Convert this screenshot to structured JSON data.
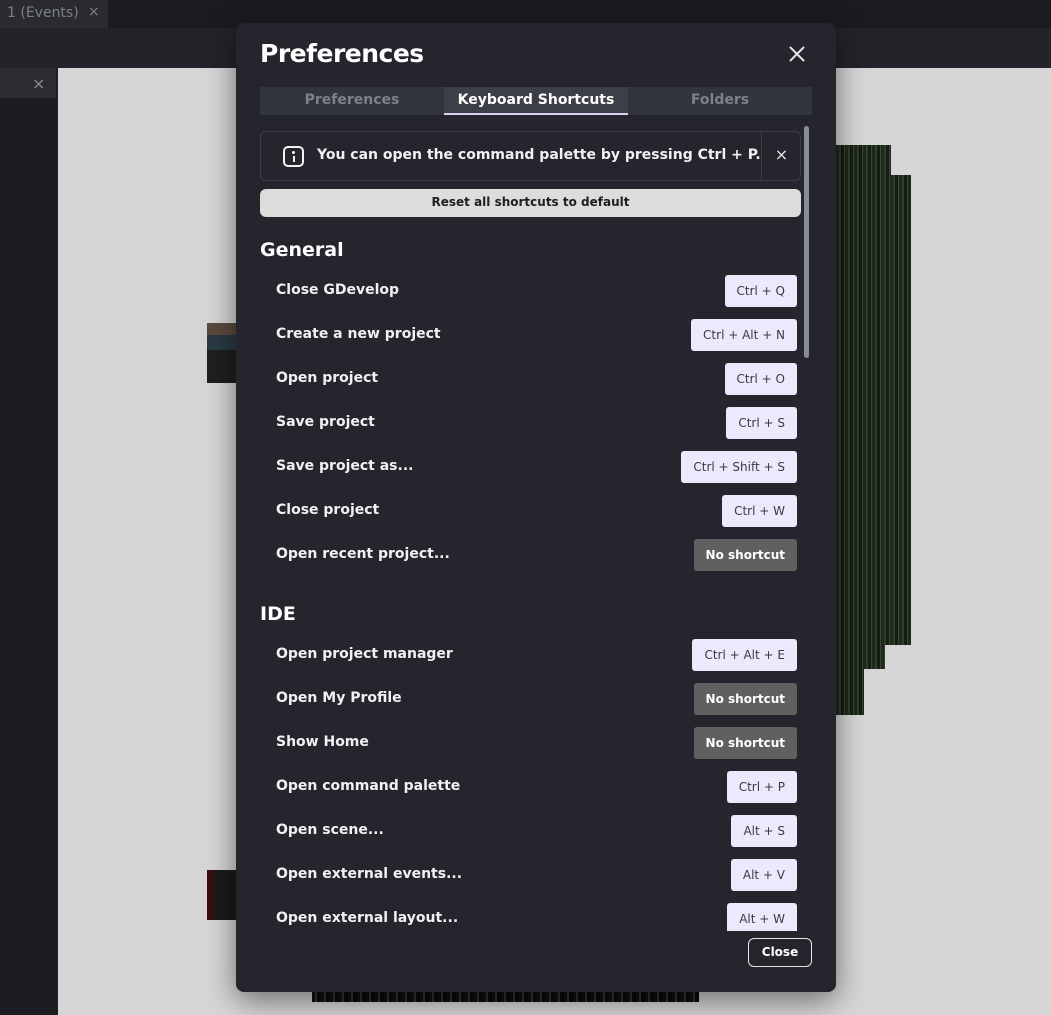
{
  "background": {
    "tab_label": "1 (Events)",
    "tab_close": "×",
    "panel_close": "×"
  },
  "dialog": {
    "title": "Preferences",
    "close_icon": "close-icon",
    "tabs": [
      {
        "label": "Preferences",
        "active": false
      },
      {
        "label": "Keyboard Shortcuts",
        "active": true
      },
      {
        "label": "Folders",
        "active": false
      }
    ],
    "info_banner": {
      "icon": "info-icon",
      "text": "You can open the command palette by pressing Ctrl + P.",
      "close": "×"
    },
    "reset_button": "Reset all shortcuts to default",
    "sections": [
      {
        "title": "General",
        "items": [
          {
            "label": "Close GDevelop",
            "shortcut": "Ctrl + Q"
          },
          {
            "label": "Create a new project",
            "shortcut": "Ctrl + Alt + N"
          },
          {
            "label": "Open project",
            "shortcut": "Ctrl + O"
          },
          {
            "label": "Save project",
            "shortcut": "Ctrl + S"
          },
          {
            "label": "Save project as...",
            "shortcut": "Ctrl + Shift + S"
          },
          {
            "label": "Close project",
            "shortcut": "Ctrl + W"
          },
          {
            "label": "Open recent project...",
            "shortcut": "No shortcut"
          }
        ]
      },
      {
        "title": "IDE",
        "items": [
          {
            "label": "Open project manager",
            "shortcut": "Ctrl + Alt + E"
          },
          {
            "label": "Open My Profile",
            "shortcut": "No shortcut"
          },
          {
            "label": "Show Home",
            "shortcut": "No shortcut"
          },
          {
            "label": "Open command palette",
            "shortcut": "Ctrl + P"
          },
          {
            "label": "Open scene...",
            "shortcut": "Alt + S"
          },
          {
            "label": "Open external events...",
            "shortcut": "Alt + V"
          },
          {
            "label": "Open external layout...",
            "shortcut": "Alt + W"
          }
        ]
      }
    ],
    "close_button": "Close"
  }
}
